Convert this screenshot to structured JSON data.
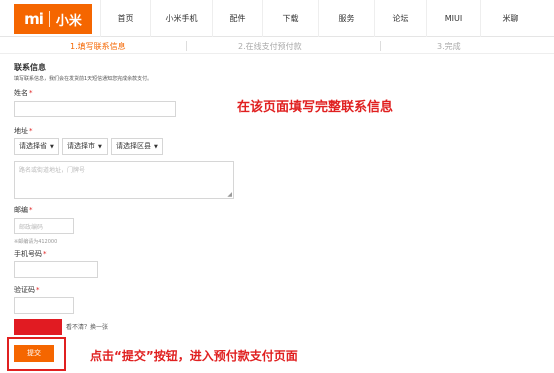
{
  "header": {
    "logo_mark": "mi",
    "logo_text": "小米",
    "nav": [
      "首页",
      "小米手机",
      "配件",
      "下载",
      "服务",
      "论坛",
      "MIUI",
      "米聊"
    ]
  },
  "steps": [
    "1.填写联系信息",
    "2.在线支付预付款",
    "3.完成"
  ],
  "form": {
    "section_title": "联系信息",
    "section_desc": "填写联系信息，我们会在发货前1天短信通知您完成余款支付。",
    "name_label": "姓名",
    "address_label": "地址",
    "province": "请选择省",
    "city": "请选择市",
    "district": "请选择区县",
    "street_placeholder": "路名或街道地址，门牌号",
    "zip_label": "邮编",
    "zip_placeholder": "邮政编码",
    "zip_hint": "※邮编请为412000",
    "phone_label": "手机号码",
    "captcha_label": "验证码",
    "captcha_refresh": "看不清？换一张",
    "submit_label": "提交",
    "required_mark": "*"
  },
  "annotations": {
    "top_note": "在该页面填写完整联系信息",
    "bottom_note": "点击“提交”按钮，进入预付款支付页面"
  },
  "colors": {
    "accent": "#f56600",
    "annotation": "#e02020"
  }
}
